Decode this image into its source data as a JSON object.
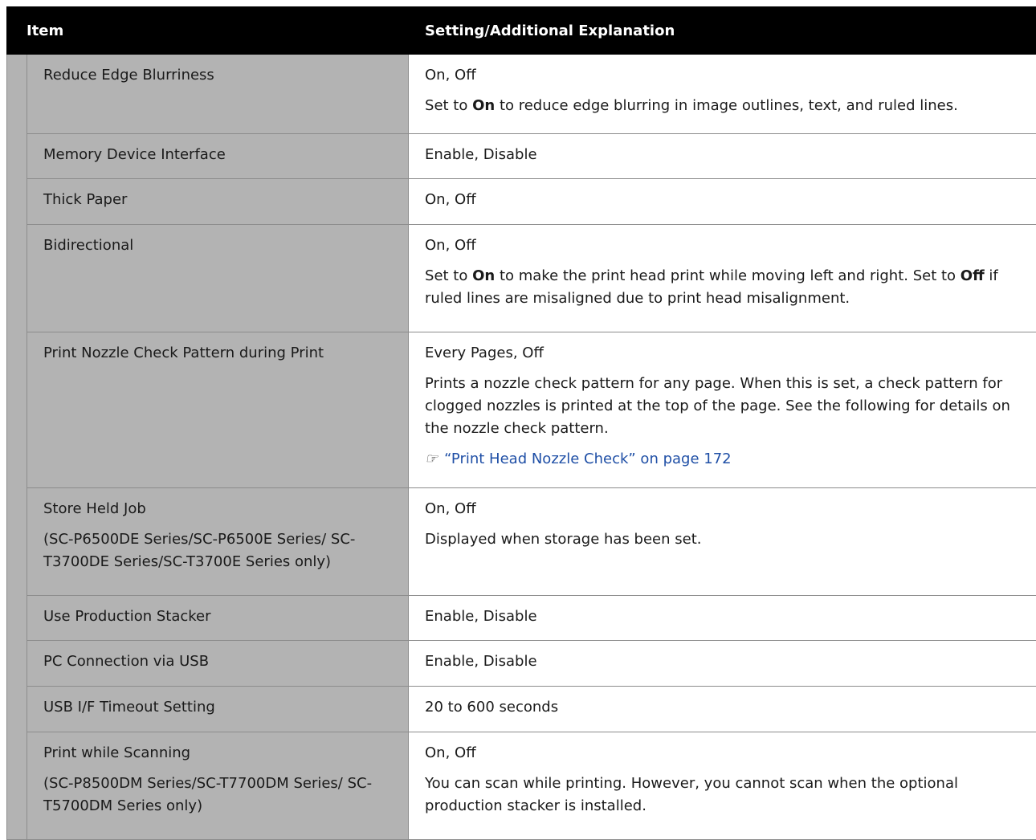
{
  "header": {
    "item": "Item",
    "setting": "Setting/Additional Explanation"
  },
  "rows": [
    {
      "item": "Reduce Edge Blurriness",
      "options": "On, Off",
      "note": {
        "pre": "Set to ",
        "b1": "On",
        "post": " to reduce edge blurring in image outlines, text, and ruled lines."
      }
    },
    {
      "item": "Memory Device Interface",
      "options": "Enable, Disable"
    },
    {
      "item": "Thick Paper",
      "options": "On, Off"
    },
    {
      "item": "Bidirectional",
      "options": "On, Off",
      "note": {
        "pre": "Set to ",
        "b1": "On",
        "mid": " to make the print head print while moving left and right. Set to ",
        "b2": "Off",
        "post": " if ruled lines are misaligned due to print head misalignment."
      }
    },
    {
      "item": "Print Nozzle Check Pattern during Print",
      "options": "Every Pages, Off",
      "note": "Prints a nozzle check pattern for any page. When this is set, a check pattern for clogged nozzles is printed at the top of the page. See the following for details on the nozzle check pattern.",
      "link": {
        "icon": "reference-pointer-icon",
        "glyph": "☞",
        "text": "“Print Head Nozzle Check” on page 172"
      }
    },
    {
      "item": "Store Held Job",
      "subnote": "(SC-P6500DE Series/SC-P6500E Series/ SC-T3700DE Series/SC-T3700E Series only)",
      "options": "On, Off",
      "note": "Displayed when storage has been set."
    },
    {
      "item": "Use Production Stacker",
      "options": "Enable, Disable"
    },
    {
      "item": "PC Connection via USB",
      "options": "Enable, Disable"
    },
    {
      "item": "USB I/F Timeout Setting",
      "options": "20 to 600 seconds"
    },
    {
      "item": "Print while Scanning",
      "subnote": "(SC-P8500DM Series/SC-T7700DM Series/ SC-T5700DM Series only)",
      "options": "On, Off",
      "note": "You can scan while printing. However, you cannot scan when the optional production stacker is installed."
    }
  ]
}
